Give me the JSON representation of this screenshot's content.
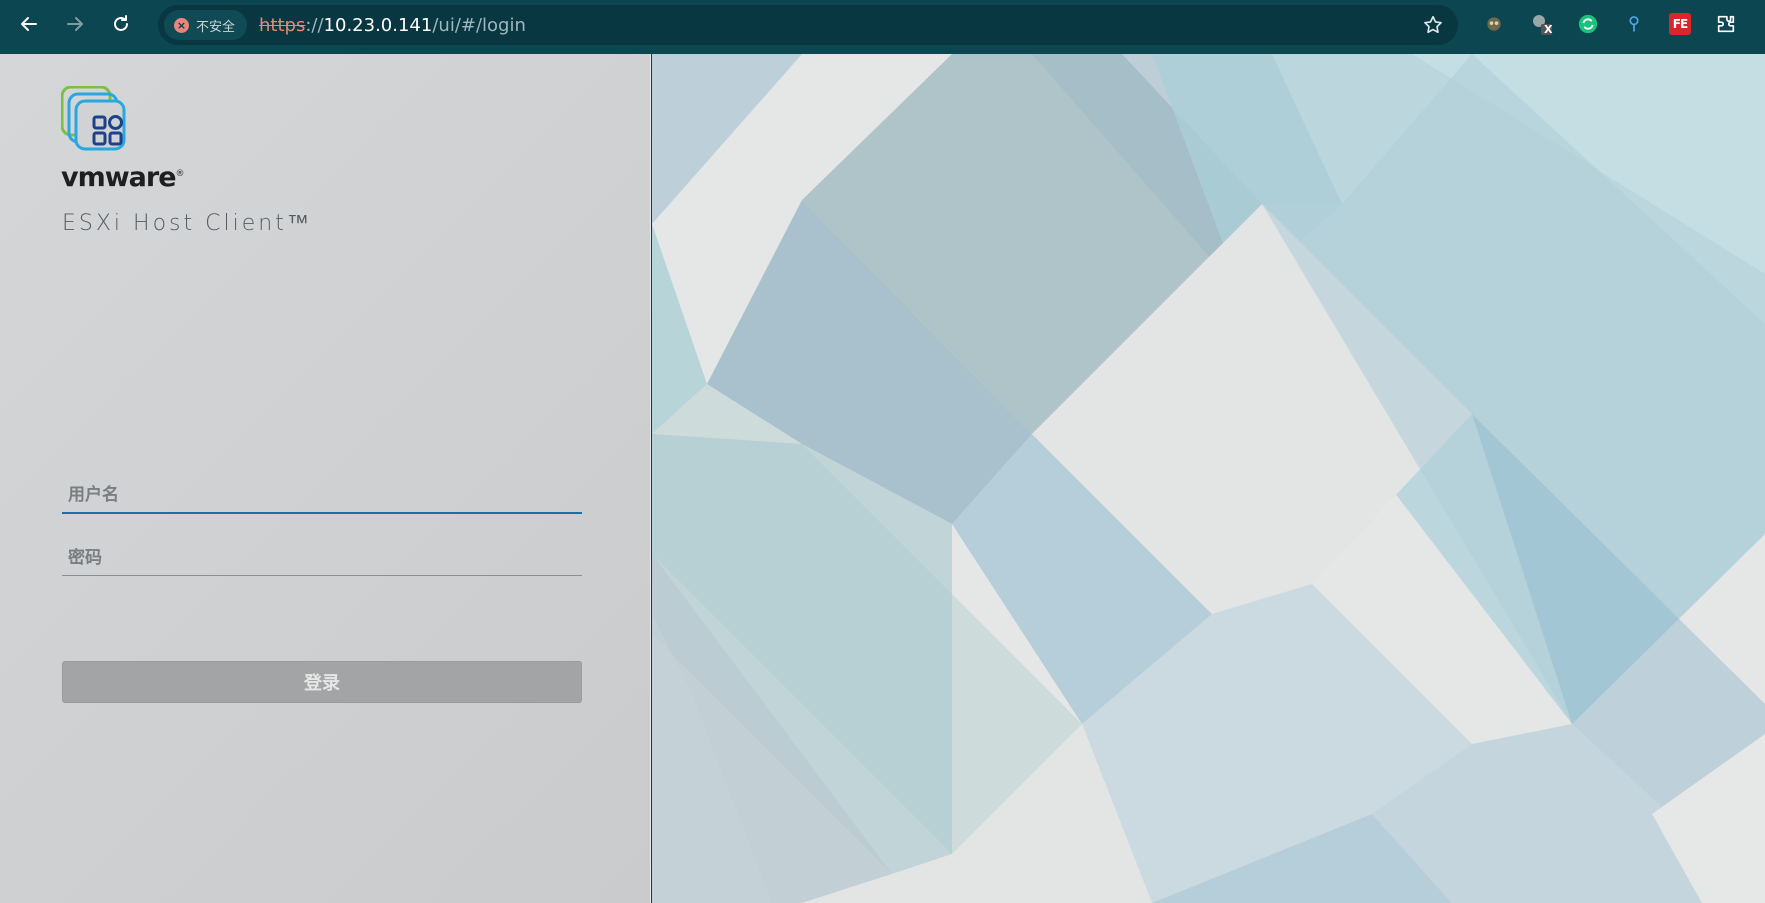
{
  "browser": {
    "security_label": "不安全",
    "url_scheme": "https",
    "url_sep": "://",
    "url_host": "10.23.0.141",
    "url_path": "/ui/#/login",
    "extensions": [
      "owl-icon",
      "puzzle-x-icon",
      "green-sync-icon",
      "pin-icon",
      "fe-icon",
      "extensions-icon"
    ],
    "fe_label": "FE",
    "ext_badge": "X"
  },
  "login": {
    "brand_vm": "vm",
    "brand_ware": "ware",
    "brand_reg": "®",
    "product_name": "ESXi Host Client™",
    "username_placeholder": "用户名",
    "password_placeholder": "密码",
    "login_label": "登录"
  },
  "colors": {
    "chrome_bg": "#0c4650",
    "focus_underline": "#1a6fa3",
    "button_disabled": "#a3a4a5"
  }
}
